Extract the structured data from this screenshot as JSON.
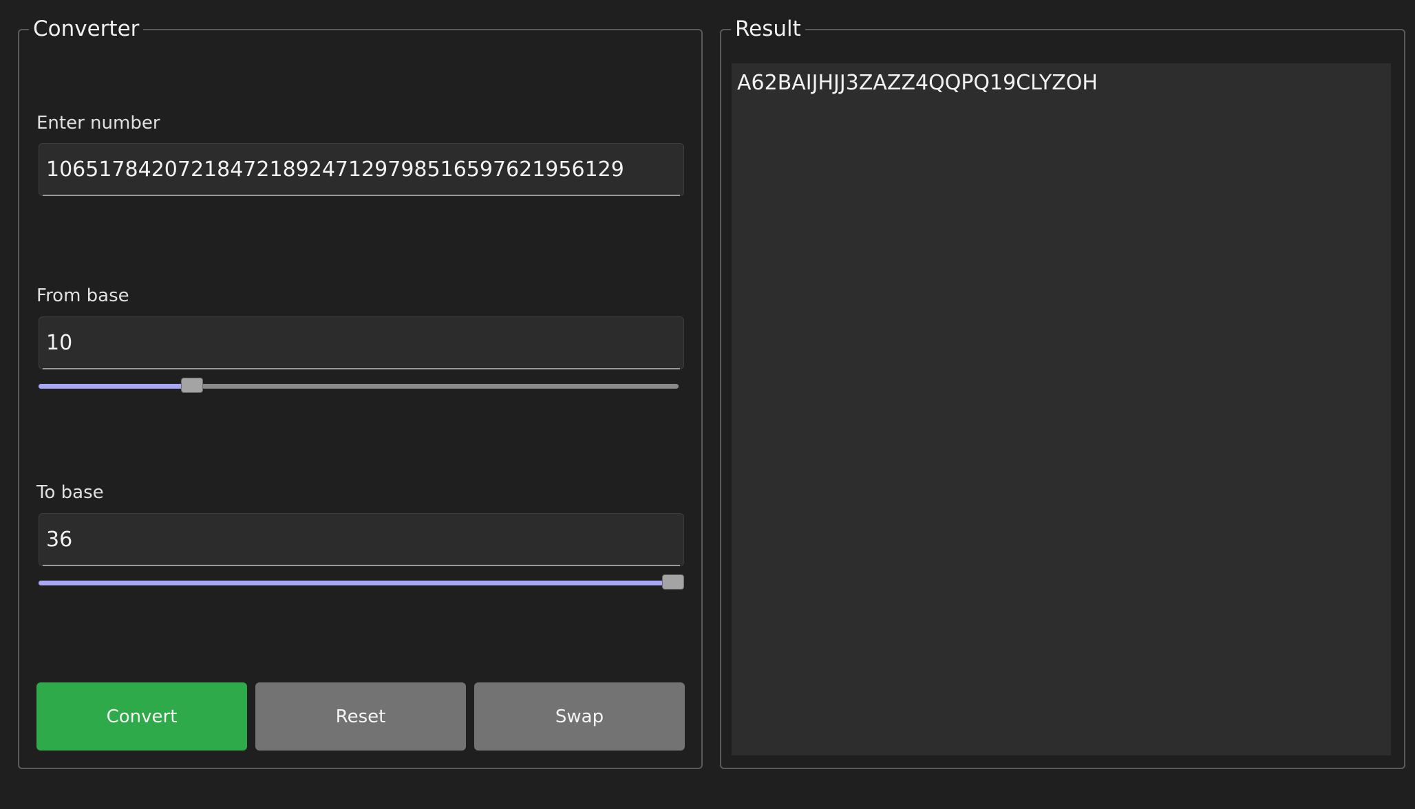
{
  "converter": {
    "title": "Converter",
    "number_label": "Enter number",
    "number_value": "106517842072184721892471297985165976219561​29",
    "from_label": "From base",
    "from_value": "10",
    "from_slider": {
      "min": 2,
      "max": 36,
      "value": 10
    },
    "to_label": "To base",
    "to_value": "36",
    "to_slider": {
      "min": 2,
      "max": 36,
      "value": 36
    },
    "buttons": {
      "convert": "Convert",
      "reset": "Reset",
      "swap": "Swap"
    }
  },
  "result": {
    "title": "Result",
    "text": "A62BAIJHJJ3ZAZZ4QQPQ19CLYZOH"
  },
  "colors": {
    "accent": "#a9a6f5",
    "convert_button": "#2faa4b",
    "secondary_button": "#737373"
  }
}
